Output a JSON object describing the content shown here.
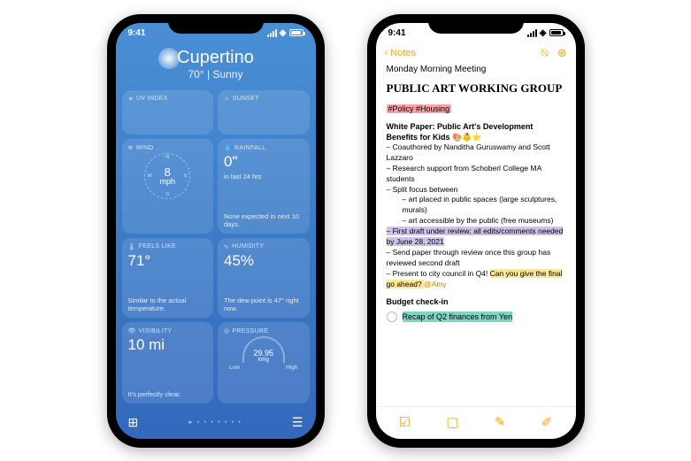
{
  "status": {
    "time": "9:41"
  },
  "weather": {
    "city": "Cupertino",
    "temp": "70°",
    "condition": "Sunny",
    "cards": {
      "uv": {
        "label": "UV INDEX"
      },
      "sunset": {
        "label": "SUNSET"
      },
      "wind": {
        "label": "WIND",
        "speed": "8",
        "unit": "mph",
        "n": "N",
        "s": "S",
        "e": "E",
        "w": "W"
      },
      "rainfall": {
        "label": "RAINFALL",
        "value": "0\"",
        "sub": "in last 24 hrs",
        "note": "None expected in next 10 days."
      },
      "feels": {
        "label": "FEELS LIKE",
        "value": "71°",
        "note": "Similar to the actual temperature."
      },
      "humidity": {
        "label": "HUMIDITY",
        "value": "45%",
        "note": "The dew point is 47° right now."
      },
      "visibility": {
        "label": "VISIBILITY",
        "value": "10 mi",
        "note": "It's perfectly clear."
      },
      "pressure": {
        "label": "PRESSURE",
        "value": "29.95",
        "unit": "inHg",
        "low": "Low",
        "high": "High"
      }
    },
    "tabbar": {
      "map": "map-icon",
      "location": "location-icon",
      "list": "list-icon"
    }
  },
  "notes": {
    "back": "Notes",
    "title": "Monday Morning Meeting",
    "heading": "PUBLIC ART WORKING GROUP",
    "tags": "#Policy #Housing",
    "paper_head": "White Paper: Public Art's Development Benefits for Kids 🎨👶⭐",
    "l1": "– Coauthored by Nanditha Guruswamy and Scott Lazzaro",
    "l2": "– Research support from Schoberl College MA students",
    "l3": "– Split focus between",
    "l3a": "– art placed in public spaces (large sculptures, murals)",
    "l3b": "– art accessible by the public (free museums)",
    "l4": "– First draft under review; all edits/comments needed by June 28, 2021",
    "l5a": "– Send paper through review once this group has reviewed second draft",
    "l5b": "– Present to city council in Q4! ",
    "l5c": "Can you give the final go ahead? ",
    "l5d": "@Amy",
    "budget_head": "Budget check-in",
    "budget_item": "Recap of Q2 finances from Yen"
  }
}
